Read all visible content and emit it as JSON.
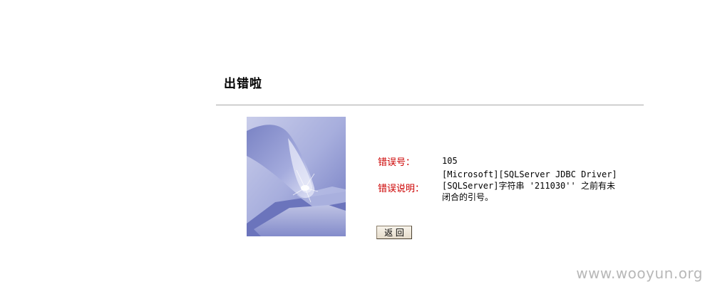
{
  "page": {
    "title": "出错啦"
  },
  "error": {
    "number_label": "错误号：",
    "number_value": "105",
    "description_label": "错误说明：",
    "description_lines": [
      "[Microsoft][SQLServer JDBC Driver]",
      "[SQLServer]字符串 '211030'' 之前有未",
      "闭合的引号。"
    ]
  },
  "actions": {
    "back_label": "返 回"
  },
  "watermark": {
    "text": "www.wooyun.org"
  },
  "illustration": {
    "icon": "finger-pressing-keyboard-key",
    "tint": "#7f88c8"
  }
}
